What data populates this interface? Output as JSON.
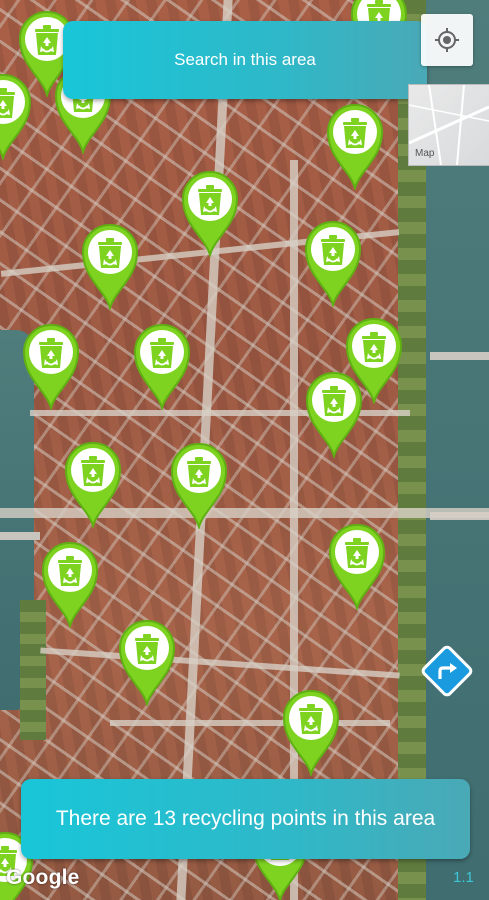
{
  "search_button": {
    "label": "Search in this area"
  },
  "map_type_toggle": {
    "label": "Map"
  },
  "info_bar": {
    "text": "There are 13 recycling points in this area"
  },
  "attribution": {
    "logo_text": "Google"
  },
  "corner_text": "1.1",
  "colors": {
    "accent": "#18c6d8",
    "pin": "#7ed321",
    "pin_dark": "#5fb012",
    "route": "#1a9be0"
  },
  "icons": {
    "pin": "recycling-bin-icon",
    "locate": "my-location-icon",
    "route": "directions-icon"
  }
}
